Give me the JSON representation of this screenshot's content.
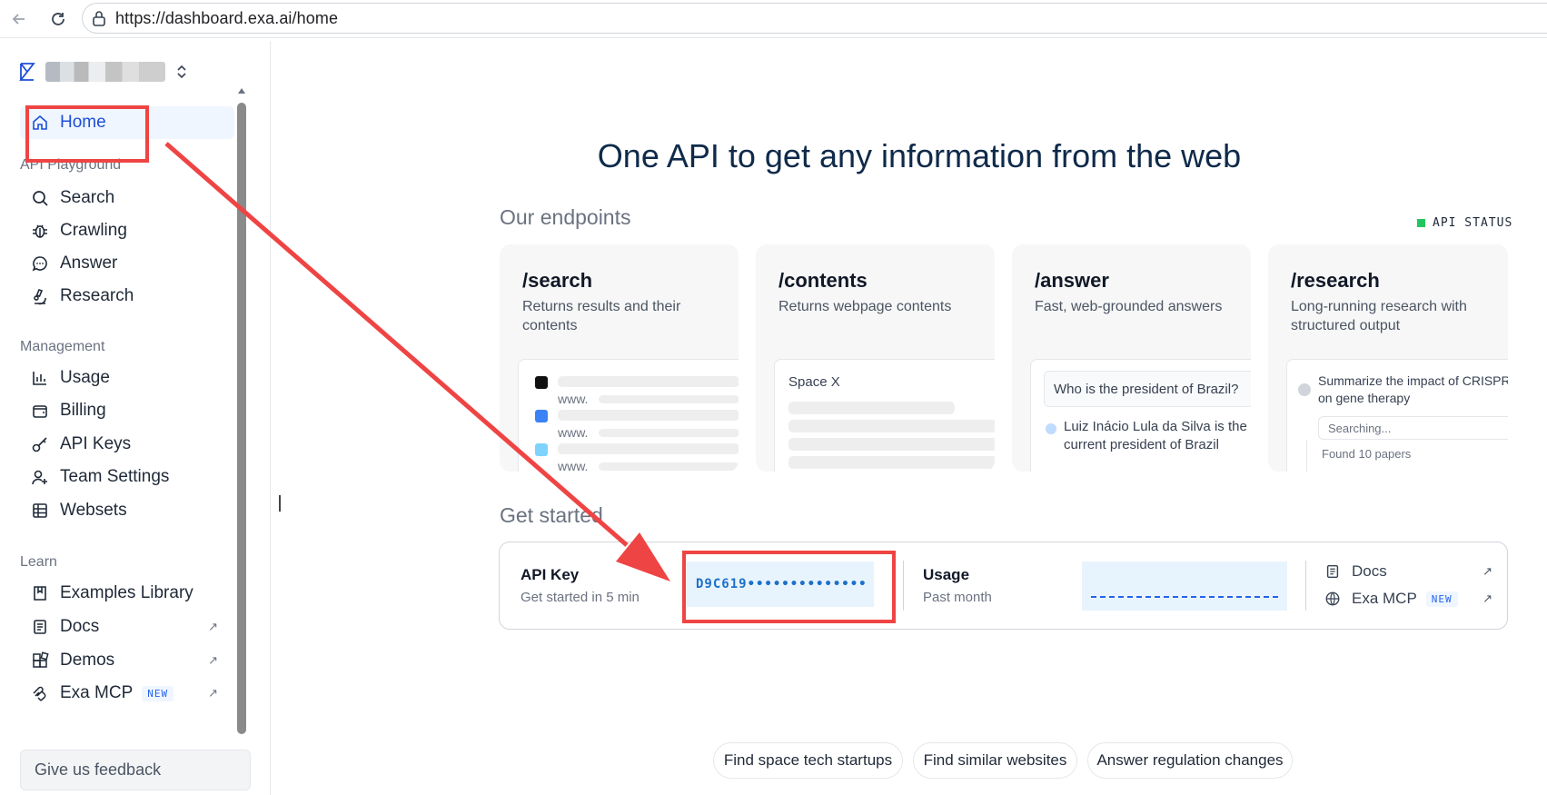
{
  "browser": {
    "url": "https://dashboard.exa.ai/home",
    "back_icon": "arrow-left-icon",
    "reload_icon": "reload-icon",
    "site_info_icon": "site-info-icon"
  },
  "sidebar": {
    "home_label": "Home",
    "sections": {
      "playground": "API Playground",
      "management": "Management",
      "learn": "Learn"
    },
    "playground_items": [
      {
        "label": "Search",
        "icon": "search-icon"
      },
      {
        "label": "Crawling",
        "icon": "bug-icon"
      },
      {
        "label": "Answer",
        "icon": "chat-icon"
      },
      {
        "label": "Research",
        "icon": "microscope-icon"
      }
    ],
    "management_items": [
      {
        "label": "Usage",
        "icon": "bar-chart-icon"
      },
      {
        "label": "Billing",
        "icon": "wallet-icon"
      },
      {
        "label": "API Keys",
        "icon": "key-icon"
      },
      {
        "label": "Team Settings",
        "icon": "user-plus-icon"
      },
      {
        "label": "Websets",
        "icon": "grid-icon"
      }
    ],
    "learn_items": [
      {
        "label": "Examples Library",
        "icon": "book-icon"
      },
      {
        "label": "Docs",
        "icon": "document-icon"
      },
      {
        "label": "Demos",
        "icon": "blocks-icon"
      },
      {
        "label": "Exa MCP",
        "icon": "mcp-icon",
        "badge": "NEW"
      }
    ],
    "feedback_label": "Give us feedback"
  },
  "main": {
    "title": "One API to get any information from the web",
    "endpoints_heading": "Our endpoints",
    "api_status": "API STATUS",
    "cards": [
      {
        "title": "/search",
        "desc": "Returns results and their contents",
        "preview_www": "www."
      },
      {
        "title": "/contents",
        "desc": "Returns webpage contents",
        "preview_text": "Space X"
      },
      {
        "title": "/answer",
        "desc": "Fast, web-grounded answers",
        "question": "Who is the president of Brazil?",
        "answer": "Luiz Inácio Lula da Silva is the current president of Brazil"
      },
      {
        "title": "/research",
        "desc": "Long-running research with structured output",
        "prompt": "Summarize the impact of CRISPR on gene therapy",
        "status": "Searching...",
        "found": "Found 10 papers"
      }
    ],
    "get_started_heading": "Get started",
    "get_started": {
      "api_key_label": "API Key",
      "api_key_sub": "Get started in 5 min",
      "api_key_value": "D9C619••••••••••••••",
      "usage_label": "Usage",
      "usage_sub": "Past month",
      "links": [
        {
          "label": "Docs",
          "icon": "document-icon"
        },
        {
          "label": "Exa MCP",
          "icon": "globe-icon",
          "badge": "NEW"
        }
      ]
    },
    "suggestions": [
      "Find space tech startups",
      "Find similar websites",
      "Answer regulation changes"
    ]
  },
  "annotation_color": "#ef4444"
}
